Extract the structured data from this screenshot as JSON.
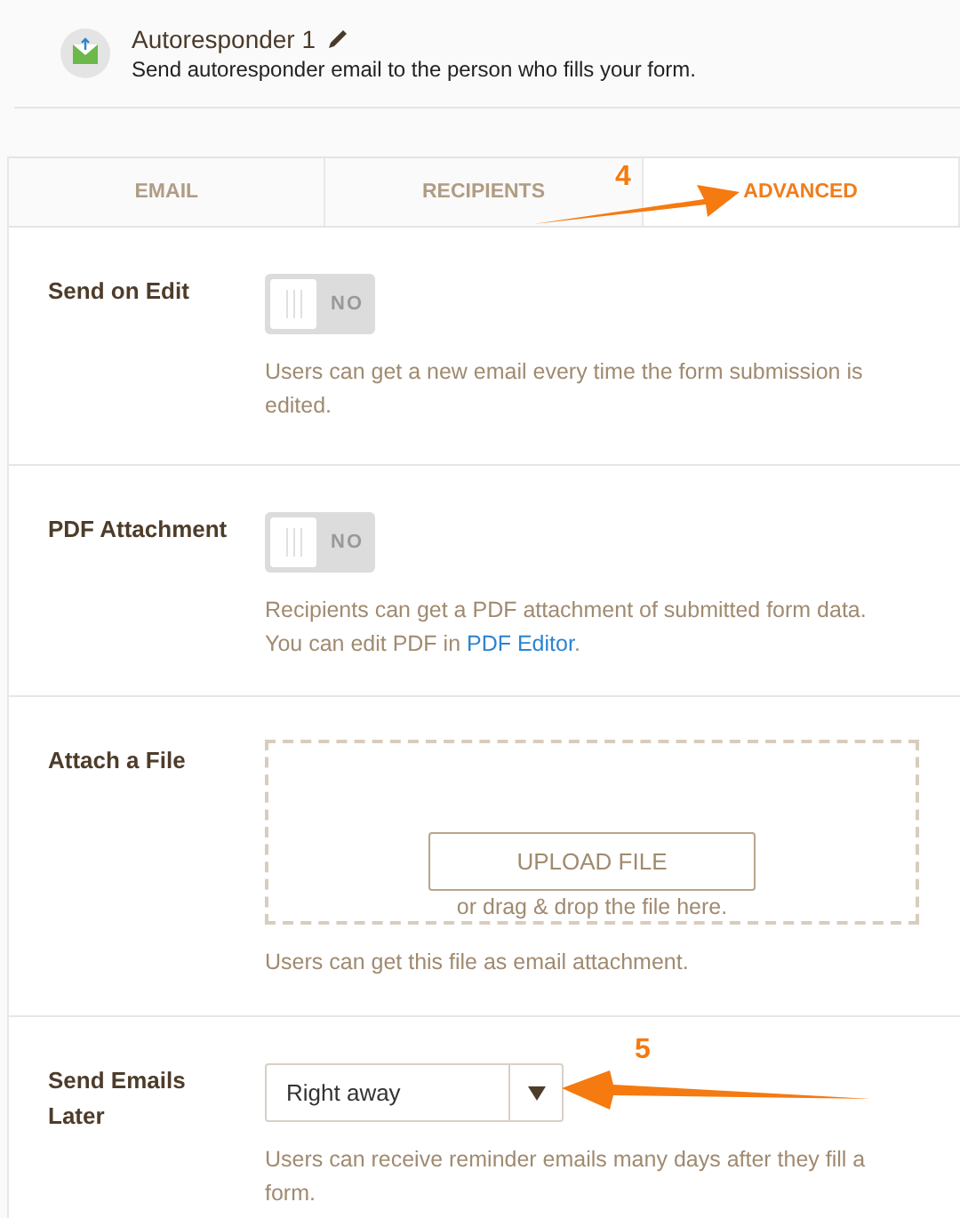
{
  "header": {
    "title": "Autoresponder 1",
    "subtitle": "Send autoresponder email to the person who fills your form."
  },
  "tabs": [
    {
      "label": "EMAIL",
      "selected": false
    },
    {
      "label": "RECIPIENTS",
      "selected": false
    },
    {
      "label": "ADVANCED",
      "selected": true
    }
  ],
  "rows": [
    {
      "kind": "toggle",
      "label": "Send on Edit",
      "on": false,
      "toggle_text": "NO",
      "description": "Users can get a new email every time the form submission is edited."
    },
    {
      "kind": "toggle",
      "label": "PDF Attachment",
      "on": false,
      "toggle_text": "NO",
      "description": "Recipients can get a PDF attachment of submitted form data. You can edit PDF in ",
      "link": "PDF Editor",
      "description_end": "."
    },
    {
      "kind": "upload",
      "label": "Attach a File",
      "button": "UPLOAD FILE",
      "drop_hint": "or drag & drop the file here.",
      "description": "Users can get this file as email attachment."
    },
    {
      "kind": "select",
      "label": "Send Emails Later",
      "value": "Right away",
      "description": "Users can receive reminder emails many days after they fill a form."
    }
  ],
  "annotations": [
    {
      "label": "4"
    },
    {
      "label": "5"
    }
  ]
}
